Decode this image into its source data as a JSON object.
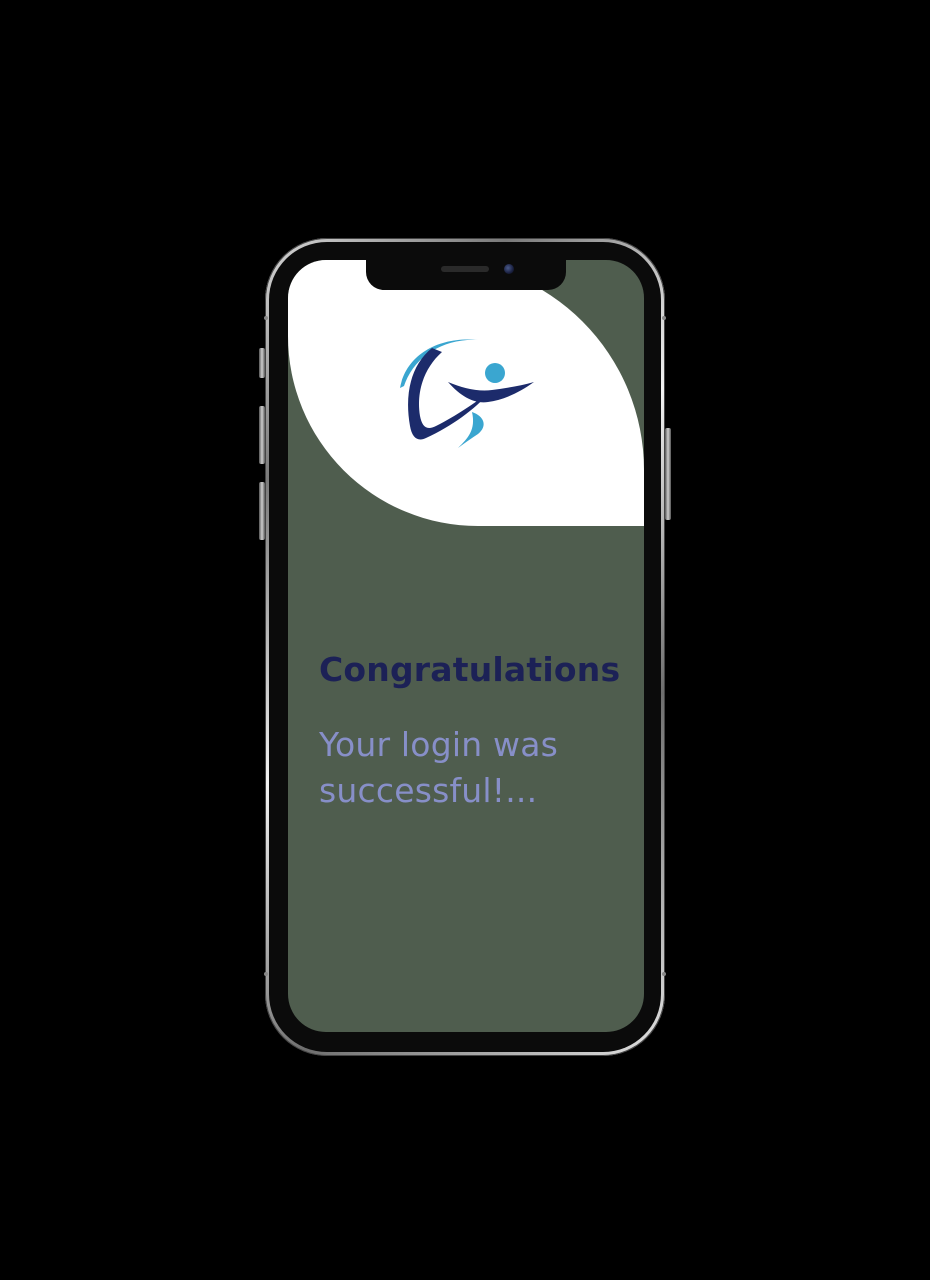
{
  "screen": {
    "title": "Congratulations",
    "message": "Your login was successful!..."
  },
  "colors": {
    "background": "#000000",
    "screen_bg": "#4f5d4e",
    "hero_bg": "#ffffff",
    "title_color": "#1c2156",
    "message_color": "#8e95d6",
    "logo_dark": "#1c2b6b",
    "logo_light": "#3aa6d0"
  },
  "icons": {
    "logo": "runner-logo-icon"
  }
}
